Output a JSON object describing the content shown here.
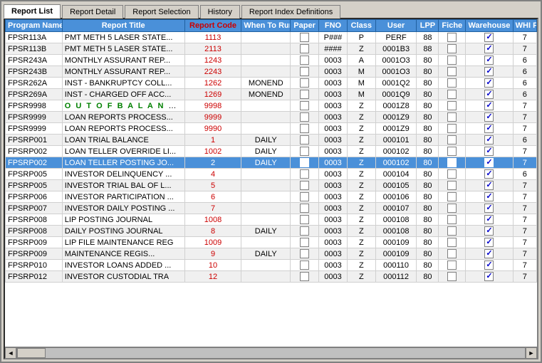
{
  "tabs": [
    {
      "id": "report-list",
      "label": "Report List",
      "active": true
    },
    {
      "id": "report-detail",
      "label": "Report Detail",
      "active": false
    },
    {
      "id": "report-selection",
      "label": "Report Selection",
      "active": false
    },
    {
      "id": "history",
      "label": "History",
      "active": false
    },
    {
      "id": "report-index",
      "label": "Report Index Definitions",
      "active": false
    }
  ],
  "columns": [
    {
      "id": "program",
      "label": "Program Name"
    },
    {
      "id": "title",
      "label": "Report Title"
    },
    {
      "id": "code",
      "label": "Report Code"
    },
    {
      "id": "when",
      "label": "When To Run"
    },
    {
      "id": "paper",
      "label": "Paper"
    },
    {
      "id": "fno",
      "label": "FNO"
    },
    {
      "id": "class",
      "label": "Class"
    },
    {
      "id": "user",
      "label": "User"
    },
    {
      "id": "lpp",
      "label": "LPP"
    },
    {
      "id": "fiche",
      "label": "Fiche"
    },
    {
      "id": "warehouse",
      "label": "Warehouse"
    },
    {
      "id": "whi",
      "label": "WHI Pri"
    }
  ],
  "rows": [
    {
      "program": "FPSR113A",
      "title": "PMT METH 5 LASER STATE...",
      "code": "1113",
      "when": "",
      "paper": false,
      "fno": "P###",
      "class": "P",
      "user": "PERF",
      "lpp": "88",
      "fiche": false,
      "warehouse": true,
      "whi": "7",
      "selected": false,
      "outofbalance": false
    },
    {
      "program": "FPSR113B",
      "title": "PMT METH 5 LASER STATE...",
      "code": "2113",
      "when": "",
      "paper": false,
      "fno": "####",
      "class": "Z",
      "user": "0001B3",
      "lpp": "88",
      "fiche": false,
      "warehouse": true,
      "whi": "7",
      "selected": false,
      "outofbalance": false
    },
    {
      "program": "FPSR243A",
      "title": "MONTHLY ASSURANT REP...",
      "code": "1243",
      "when": "",
      "paper": false,
      "fno": "0003",
      "class": "A",
      "user": "0001O3",
      "lpp": "80",
      "fiche": false,
      "warehouse": true,
      "whi": "6",
      "selected": false,
      "outofbalance": false
    },
    {
      "program": "FPSR243B",
      "title": "MONTHLY ASSURANT REP...",
      "code": "2243",
      "when": "",
      "paper": false,
      "fno": "0003",
      "class": "M",
      "user": "0001O3",
      "lpp": "80",
      "fiche": false,
      "warehouse": true,
      "whi": "6",
      "selected": false,
      "outofbalance": false
    },
    {
      "program": "FPSR262A",
      "title": "INST - BANKRUPTCY COLL...",
      "code": "1262",
      "when": "MONEND",
      "paper": false,
      "fno": "0003",
      "class": "M",
      "user": "0001Q2",
      "lpp": "80",
      "fiche": false,
      "warehouse": true,
      "whi": "6",
      "selected": false,
      "outofbalance": false
    },
    {
      "program": "FPSR269A",
      "title": "INST - CHARGED OFF ACC...",
      "code": "1269",
      "when": "MONEND",
      "paper": false,
      "fno": "0003",
      "class": "M",
      "user": "0001Q9",
      "lpp": "80",
      "fiche": false,
      "warehouse": true,
      "whi": "6",
      "selected": false,
      "outofbalance": false
    },
    {
      "program": "FPSR9998",
      "title": "OUT OF BALANCE RE",
      "code": "9998",
      "when": "",
      "paper": false,
      "fno": "0003",
      "class": "Z",
      "user": "0001Z8",
      "lpp": "80",
      "fiche": false,
      "warehouse": true,
      "whi": "7",
      "selected": false,
      "outofbalance": true
    },
    {
      "program": "FPSR9999",
      "title": "LOAN REPORTS PROCESS...",
      "code": "9999",
      "when": "",
      "paper": false,
      "fno": "0003",
      "class": "Z",
      "user": "0001Z9",
      "lpp": "80",
      "fiche": false,
      "warehouse": true,
      "whi": "7",
      "selected": false,
      "outofbalance": false
    },
    {
      "program": "FPSR9999",
      "title": "LOAN REPORTS PROCESS...",
      "code": "9990",
      "when": "",
      "paper": false,
      "fno": "0003",
      "class": "Z",
      "user": "0001Z9",
      "lpp": "80",
      "fiche": false,
      "warehouse": true,
      "whi": "7",
      "selected": false,
      "outofbalance": false
    },
    {
      "program": "FPSRP001",
      "title": "LOAN TRIAL BALANCE",
      "code": "1",
      "when": "DAILY",
      "paper": false,
      "fno": "0003",
      "class": "Z",
      "user": "000101",
      "lpp": "80",
      "fiche": false,
      "warehouse": true,
      "whi": "6",
      "selected": false,
      "outofbalance": false
    },
    {
      "program": "FPSRP002",
      "title": "LOAN TELLER OVERRIDE LI...",
      "code": "1002",
      "when": "DAILY",
      "paper": false,
      "fno": "0003",
      "class": "Z",
      "user": "000102",
      "lpp": "80",
      "fiche": false,
      "warehouse": true,
      "whi": "7",
      "selected": false,
      "outofbalance": false
    },
    {
      "program": "FPSRP002",
      "title": "LOAN TELLER POSTING JO...",
      "code": "2",
      "when": "DAILY",
      "paper": false,
      "fno": "0003",
      "class": "Z",
      "user": "000102",
      "lpp": "80",
      "fiche": false,
      "warehouse": true,
      "whi": "7",
      "selected": true,
      "outofbalance": false
    },
    {
      "program": "FPSRP005",
      "title": "INVESTOR DELINQUENCY ...",
      "code": "4",
      "when": "",
      "paper": false,
      "fno": "0003",
      "class": "Z",
      "user": "000104",
      "lpp": "80",
      "fiche": false,
      "warehouse": true,
      "whi": "6",
      "selected": false,
      "outofbalance": false
    },
    {
      "program": "FPSRP005",
      "title": "INVESTOR TRIAL BAL OF L...",
      "code": "5",
      "when": "",
      "paper": false,
      "fno": "0003",
      "class": "Z",
      "user": "000105",
      "lpp": "80",
      "fiche": false,
      "warehouse": true,
      "whi": "7",
      "selected": false,
      "outofbalance": false
    },
    {
      "program": "FPSRP006",
      "title": "INVESTOR PARTICIPATION ...",
      "code": "6",
      "when": "",
      "paper": false,
      "fno": "0003",
      "class": "Z",
      "user": "000106",
      "lpp": "80",
      "fiche": false,
      "warehouse": true,
      "whi": "7",
      "selected": false,
      "outofbalance": false
    },
    {
      "program": "FPSRP007",
      "title": "INVESTOR DAILY POSTING ...",
      "code": "7",
      "when": "",
      "paper": false,
      "fno": "0003",
      "class": "Z",
      "user": "000107",
      "lpp": "80",
      "fiche": false,
      "warehouse": true,
      "whi": "7",
      "selected": false,
      "outofbalance": false
    },
    {
      "program": "FPSRP008",
      "title": "LIP POSTING JOURNAL",
      "code": "1008",
      "when": "",
      "paper": false,
      "fno": "0003",
      "class": "Z",
      "user": "000108",
      "lpp": "80",
      "fiche": false,
      "warehouse": true,
      "whi": "7",
      "selected": false,
      "outofbalance": false
    },
    {
      "program": "FPSRP008",
      "title": "DAILY POSTING JOURNAL",
      "code": "8",
      "when": "DAILY",
      "paper": false,
      "fno": "0003",
      "class": "Z",
      "user": "000108",
      "lpp": "80",
      "fiche": false,
      "warehouse": true,
      "whi": "7",
      "selected": false,
      "outofbalance": false
    },
    {
      "program": "FPSRP009",
      "title": "LIP FILE MAINTENANCE REG",
      "code": "1009",
      "when": "",
      "paper": false,
      "fno": "0003",
      "class": "Z",
      "user": "000109",
      "lpp": "80",
      "fiche": false,
      "warehouse": true,
      "whi": "7",
      "selected": false,
      "outofbalance": false
    },
    {
      "program": "FPSRP009",
      "title": "MAINTENANCE REGIS...",
      "code": "9",
      "when": "DAILY",
      "paper": false,
      "fno": "0003",
      "class": "Z",
      "user": "000109",
      "lpp": "80",
      "fiche": false,
      "warehouse": true,
      "whi": "7",
      "selected": false,
      "outofbalance": false
    },
    {
      "program": "FPSRP010",
      "title": "INVESTOR LOANS ADDED ...",
      "code": "10",
      "when": "",
      "paper": false,
      "fno": "0003",
      "class": "Z",
      "user": "000110",
      "lpp": "80",
      "fiche": false,
      "warehouse": true,
      "whi": "7",
      "selected": false,
      "outofbalance": false
    },
    {
      "program": "FPSRP012",
      "title": "INVESTOR CUSTODIAL TRA",
      "code": "12",
      "when": "",
      "paper": false,
      "fno": "0003",
      "class": "Z",
      "user": "000112",
      "lpp": "80",
      "fiche": false,
      "warehouse": true,
      "whi": "7",
      "selected": false,
      "outofbalance": false
    }
  ],
  "scrollbar": {
    "left_arrow": "◄",
    "right_arrow": "►"
  }
}
